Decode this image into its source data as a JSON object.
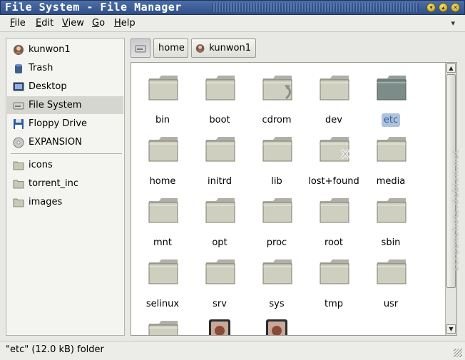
{
  "window": {
    "title": "File System - File Manager"
  },
  "menubar": {
    "items": [
      {
        "label": "File",
        "mnemonic": "F",
        "rest": "ile"
      },
      {
        "label": "Edit",
        "mnemonic": "E",
        "rest": "dit"
      },
      {
        "label": "View",
        "mnemonic": "V",
        "rest": "iew"
      },
      {
        "label": "Go",
        "mnemonic": "G",
        "rest": "o"
      },
      {
        "label": "Help",
        "mnemonic": "H",
        "rest": "elp"
      }
    ]
  },
  "sidebar": {
    "places": [
      {
        "label": "kunwon1",
        "icon": "home-user-icon"
      },
      {
        "label": "Trash",
        "icon": "trash-icon"
      },
      {
        "label": "Desktop",
        "icon": "desktop-icon"
      },
      {
        "label": "File System",
        "icon": "harddisk-icon",
        "selected": true
      },
      {
        "label": "Floppy Drive",
        "icon": "floppy-icon"
      },
      {
        "label": "EXPANSION",
        "icon": "drive-icon"
      }
    ],
    "bookmarks": [
      {
        "label": "icons",
        "icon": "folder-icon"
      },
      {
        "label": "torrent_inc",
        "icon": "folder-icon"
      },
      {
        "label": "images",
        "icon": "folder-icon"
      }
    ]
  },
  "pathbar": {
    "buttons": [
      {
        "label": "",
        "icon": "harddisk-icon",
        "pressed": true
      },
      {
        "label": "home",
        "icon": ""
      },
      {
        "label": "kunwon1",
        "icon": "home-user-icon"
      }
    ]
  },
  "files": [
    {
      "name": "bin"
    },
    {
      "name": "boot"
    },
    {
      "name": "cdrom",
      "emblem": "symlink"
    },
    {
      "name": "dev"
    },
    {
      "name": "etc",
      "selected": true
    },
    {
      "name": "home"
    },
    {
      "name": "initrd"
    },
    {
      "name": "lib"
    },
    {
      "name": "lost+found",
      "emblem": "noaccess"
    },
    {
      "name": "media"
    },
    {
      "name": "mnt"
    },
    {
      "name": "opt"
    },
    {
      "name": "proc"
    },
    {
      "name": "root"
    },
    {
      "name": "sbin"
    },
    {
      "name": "selinux"
    },
    {
      "name": "srv"
    },
    {
      "name": "sys"
    },
    {
      "name": "tmp"
    },
    {
      "name": "usr"
    },
    {
      "name": ""
    },
    {
      "name": "",
      "kind": "image"
    },
    {
      "name": "",
      "kind": "image"
    }
  ],
  "status": {
    "text": "\"etc\" (12.0 kB) folder"
  },
  "watermark": "screenshots.debian.net",
  "colors": {
    "titlebar": "#3b5998",
    "selection": "#aec2dc",
    "folder": "#cfcfc0",
    "folder_selected": "#7c8c88"
  }
}
